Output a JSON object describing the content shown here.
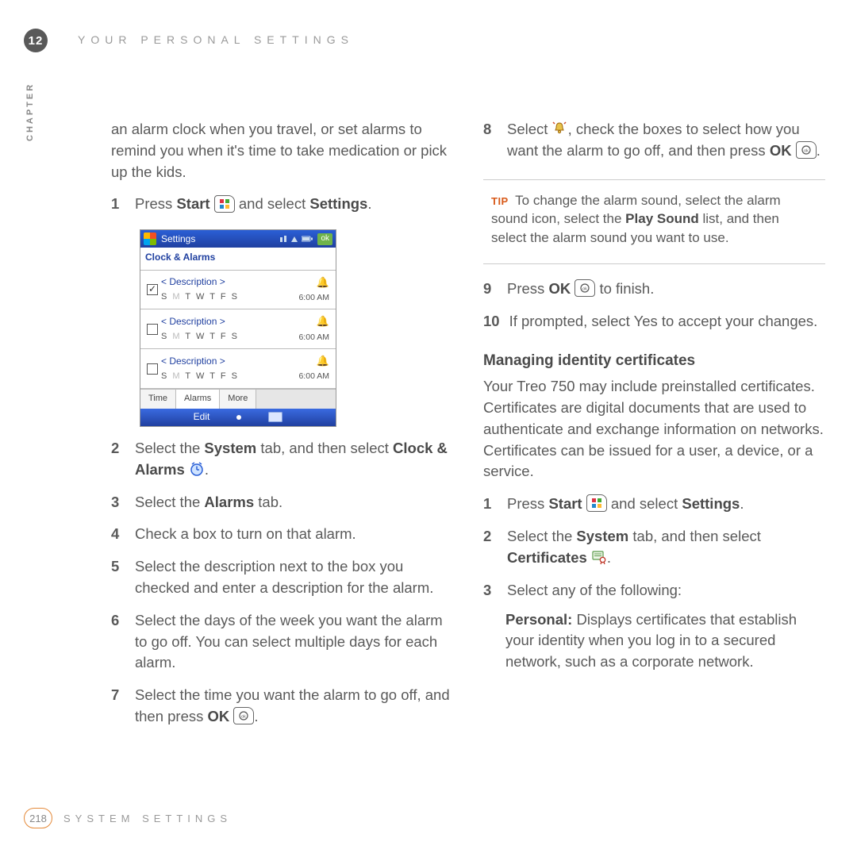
{
  "chapter": {
    "number": "12",
    "label": "CHAPTER",
    "running_head": "YOUR PERSONAL SETTINGS"
  },
  "footer": {
    "page": "218",
    "section": "SYSTEM SETTINGS"
  },
  "left": {
    "intro": "an alarm clock when you travel, or set alarms to remind you when it's time to take medication or pick up the kids.",
    "steps": {
      "s1a": "Press ",
      "s1b": "Start",
      "s1c": " and select ",
      "s1d": "Settings",
      "s1e": ".",
      "s2a": "Select the ",
      "s2b": "System",
      "s2c": " tab, and then select ",
      "s2d": "Clock & Alarms",
      "s2e": ".",
      "s3a": "Select the ",
      "s3b": "Alarms",
      "s3c": " tab.",
      "s4": "Check a box to turn on that alarm.",
      "s5": "Select the description next to the box you checked and enter a description for the alarm.",
      "s6": "Select the days of the week you want the alarm to go off. You can select multiple days for each alarm.",
      "s7a": "Select the time you want the alarm to go off, and then press ",
      "s7b": "OK",
      "s7c": "."
    }
  },
  "right": {
    "s8a": "Select ",
    "s8b": ", check the boxes to select how you want the alarm to go off, and then press ",
    "s8c": "OK",
    "s8d": ".",
    "tip_label": "TIP",
    "tip_a": "To change the alarm sound, select the alarm sound icon, select the ",
    "tip_b": "Play Sound",
    "tip_c": " list, and then select the alarm sound you want to use.",
    "s9a": "Press ",
    "s9b": "OK",
    "s9c": " to finish.",
    "s10": "If prompted, select Yes to accept your changes.",
    "subhead": "Managing identity certificates",
    "cert_intro": "Your Treo 750 may include preinstalled certificates. Certificates are digital documents that are used to authenticate and exchange information on networks. Certificates can be issued for a user, a device, or a service.",
    "c1a": "Press ",
    "c1b": "Start",
    "c1c": " and select ",
    "c1d": "Settings",
    "c1e": ".",
    "c2a": "Select the ",
    "c2b": "System",
    "c2c": " tab, and then select ",
    "c2d": "Certificates",
    "c2e": ".",
    "c3": "Select any of the following:",
    "personal_label": "Personal:",
    "personal_text": " Displays certificates that establish your identity when you log in to a secured network, such as a corporate network."
  },
  "screenshot": {
    "title": "Settings",
    "ok": "ok",
    "sub": "Clock & Alarms",
    "rows": [
      {
        "checked": true,
        "desc": "< Description >",
        "days": "S M T W T F S",
        "time": "6:00 AM"
      },
      {
        "checked": false,
        "desc": "< Description >",
        "days": "S M T W T F S",
        "time": "6:00 AM"
      },
      {
        "checked": false,
        "desc": "< Description >",
        "days": "S M T W T F S",
        "time": "6:00 AM"
      }
    ],
    "tabs": [
      "Time",
      "Alarms",
      "More"
    ],
    "footer": "Edit"
  },
  "nums": {
    "n1": "1",
    "n2": "2",
    "n3": "3",
    "n4": "4",
    "n5": "5",
    "n6": "6",
    "n7": "7",
    "n8": "8",
    "n9": "9",
    "n10": "10"
  }
}
